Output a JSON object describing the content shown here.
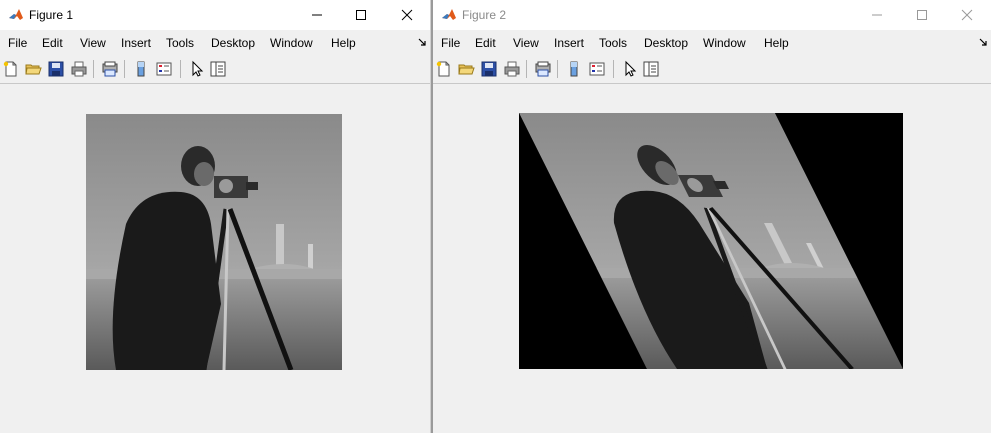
{
  "windows": [
    {
      "title": "Figure 1",
      "active": true,
      "menu": [
        "File",
        "Edit",
        "View",
        "Insert",
        "Tools",
        "Desktop",
        "Window",
        "Help"
      ]
    },
    {
      "title": "Figure 2",
      "active": false,
      "menu": [
        "File",
        "Edit",
        "View",
        "Insert",
        "Tools",
        "Desktop",
        "Window",
        "Help"
      ]
    }
  ],
  "toolbar_icons": [
    "new-figure-icon",
    "open-file-icon",
    "save-icon",
    "print-icon",
    "print-preview-icon",
    "colorbar-icon",
    "legend-icon",
    "select-arrow-icon",
    "property-editor-icon"
  ],
  "figure1": {
    "image": "cameraman photograph (grayscale)"
  },
  "figure2": {
    "image": "cameraman photograph sheared horizontally with black fill"
  },
  "colors": {
    "accent": "#e05a1a",
    "titlebar_bg": "#ffffff",
    "window_bg": "#f0f0f0"
  }
}
